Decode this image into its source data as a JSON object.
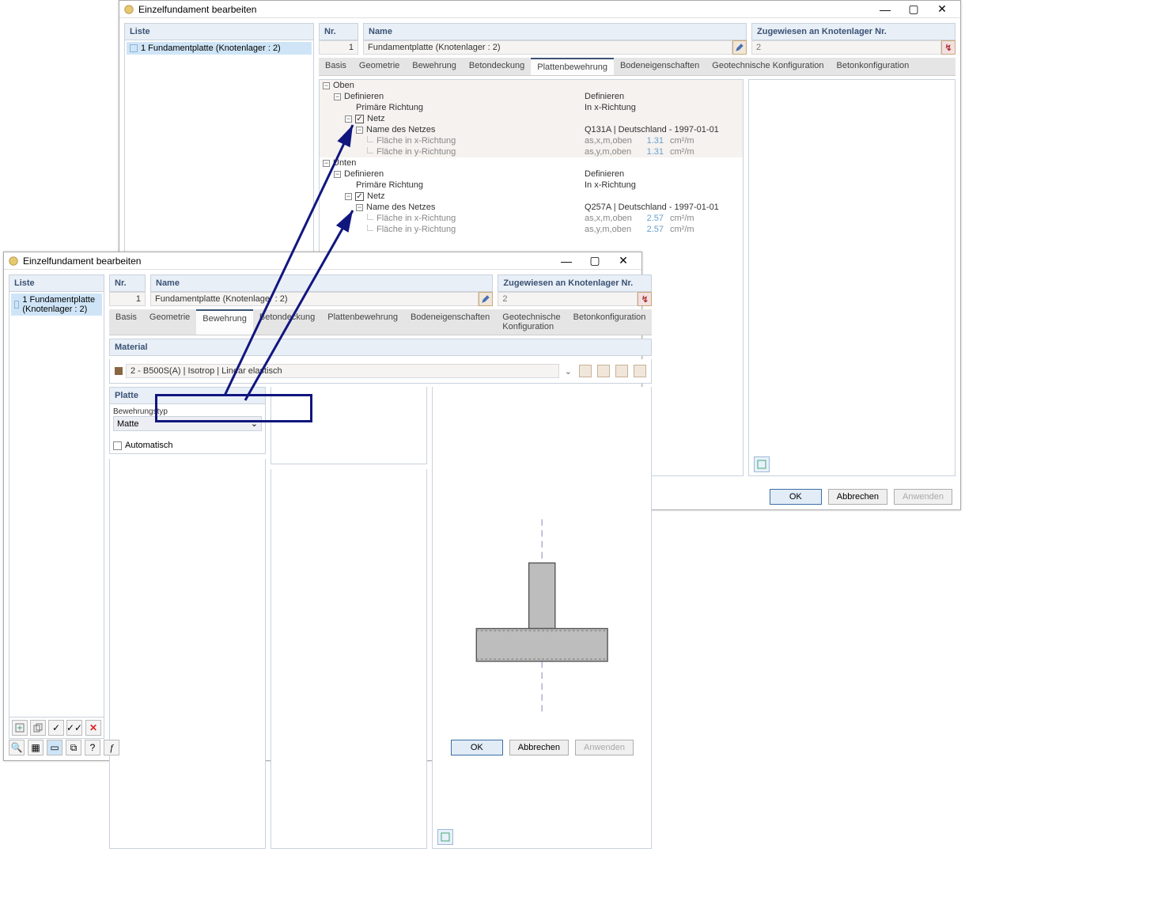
{
  "win1": {
    "title": "Einzelfundament bearbeiten",
    "list_header": "Liste",
    "list_item": "1 Fundamentplatte (Knotenlager : 2)",
    "nr_header": "Nr.",
    "nr_val": "1",
    "name_header": "Name",
    "name_val": "Fundamentplatte (Knotenlager : 2)",
    "assigned_header": "Zugewiesen an Knotenlager Nr.",
    "assigned_val": "2",
    "tabs": [
      "Basis",
      "Geometrie",
      "Bewehrung",
      "Betondeckung",
      "Plattenbewehrung",
      "Bodeneigenschaften",
      "Geotechnische Konfiguration",
      "Betonkonfiguration"
    ],
    "sec_top": "Oben",
    "sec_bottom": "Unten",
    "def": "Definieren",
    "primdir": "Primäre Richtung",
    "netz": "Netz",
    "netname": "Name des Netzes",
    "fx": "Fläche in x-Richtung",
    "fy": "Fläche in y-Richtung",
    "defR": "Definieren",
    "inx": "In x-Richtung",
    "mesh1": "Q131A | Deutschland - 1997-01-01",
    "mesh2": "Q257A | Deutschland - 1997-01-01",
    "v131": "1.31",
    "v257": "2.57",
    "unit": "cm²/m",
    "axo": "as,x,m,oben",
    "ayo": "as,y,m,oben",
    "ok": "OK",
    "cancel": "Abbrechen",
    "apply": "Anwenden"
  },
  "win2": {
    "title": "Einzelfundament bearbeiten",
    "list_header": "Liste",
    "list_item": "1 Fundamentplatte (Knotenlager : 2)",
    "nr_header": "Nr.",
    "nr_val": "1",
    "name_header": "Name",
    "name_val": "Fundamentplatte (Knotenlager : 2)",
    "assigned_header": "Zugewiesen an Knotenlager Nr.",
    "assigned_val": "2",
    "tabs": [
      "Basis",
      "Geometrie",
      "Bewehrung",
      "Betondeckung",
      "Plattenbewehrung",
      "Bodeneigenschaften",
      "Geotechnische Konfiguration",
      "Betonkonfiguration"
    ],
    "material_header": "Material",
    "material_val": "2 - B500S(A) | Isotrop | Linear elastisch",
    "plate_header": "Platte",
    "bewtyp_label": "Bewehrungstyp",
    "bewtyp_val": "Matte",
    "auto_label": "Automatisch",
    "ok": "OK",
    "cancel": "Abbrechen",
    "apply": "Anwenden"
  }
}
